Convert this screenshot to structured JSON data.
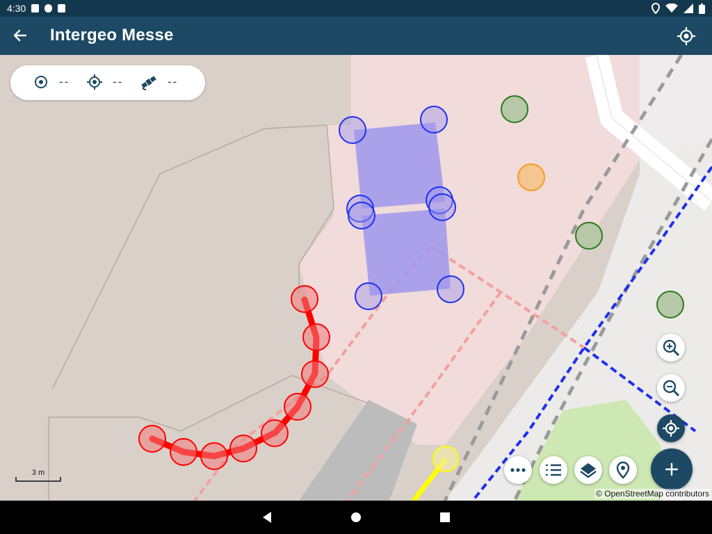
{
  "status": {
    "time": "4:30"
  },
  "appbar": {
    "title": "Intergeo Messe"
  },
  "info": {
    "position_value": "--",
    "accuracy_value": "--",
    "satellites_value": "--"
  },
  "map": {
    "scale_label": "3 m",
    "attribution": "© OpenStreetMap contributors"
  },
  "colors": {
    "primary": "#1d4964",
    "statusbar": "#13384e",
    "polygon_fill": "#9f97ec",
    "line_red": "#ff0000",
    "line_yellow": "#ffff00"
  },
  "icons": [
    "back-arrow-icon",
    "gps-target-icon",
    "crosshair-icon",
    "satellite-icon",
    "zoom-in-icon",
    "zoom-out-icon",
    "more-icon",
    "list-icon",
    "layers-icon",
    "marker-icon",
    "plus-icon"
  ]
}
